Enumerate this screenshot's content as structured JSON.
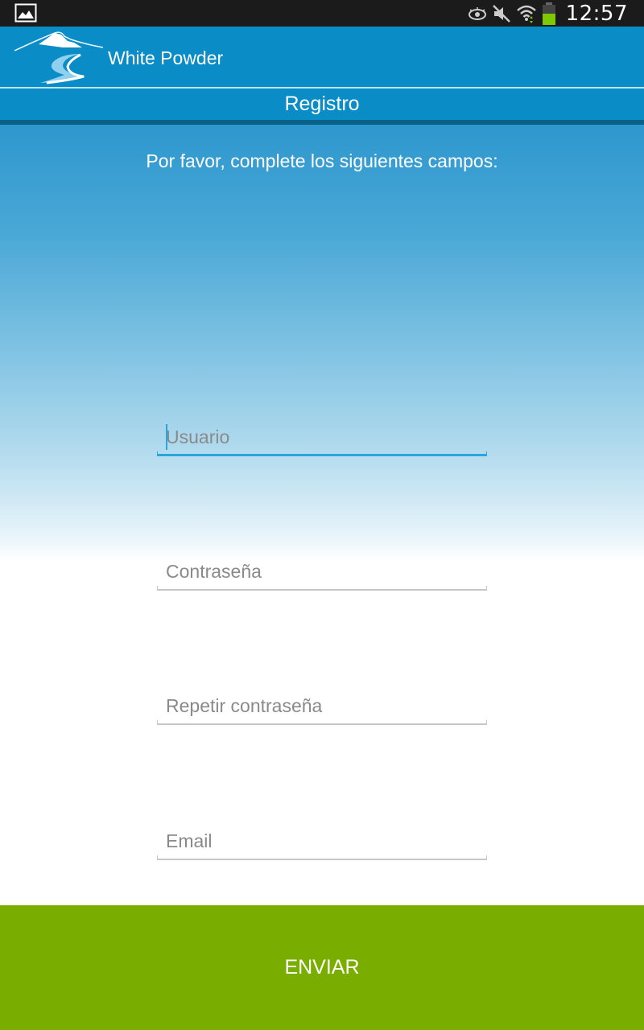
{
  "status_bar": {
    "time": "12:57",
    "icons": [
      "gallery-notification-icon",
      "eye-icon",
      "mute-icon",
      "wifi-icon",
      "battery-icon"
    ]
  },
  "app_bar": {
    "title": "White Powder",
    "logo": "mountain-road-logo"
  },
  "sub_header": {
    "title": "Registro"
  },
  "form": {
    "instructions": "Por favor, complete los siguientes campos:",
    "fields": [
      {
        "name": "username",
        "placeholder": "Usuario",
        "value": "",
        "focused": true
      },
      {
        "name": "password",
        "placeholder": "Contraseña",
        "value": "",
        "focused": false
      },
      {
        "name": "repeat_password",
        "placeholder": "Repetir contraseña",
        "value": "",
        "focused": false
      },
      {
        "name": "email",
        "placeholder": "Email",
        "value": "",
        "focused": false
      }
    ],
    "submit_label": "ENVIAR"
  },
  "colors": {
    "status_bar": "#1b1b1b",
    "app_bar": "#0a8cc6",
    "accent_focus": "#2aa6dd",
    "submit_button": "#79ae00"
  }
}
